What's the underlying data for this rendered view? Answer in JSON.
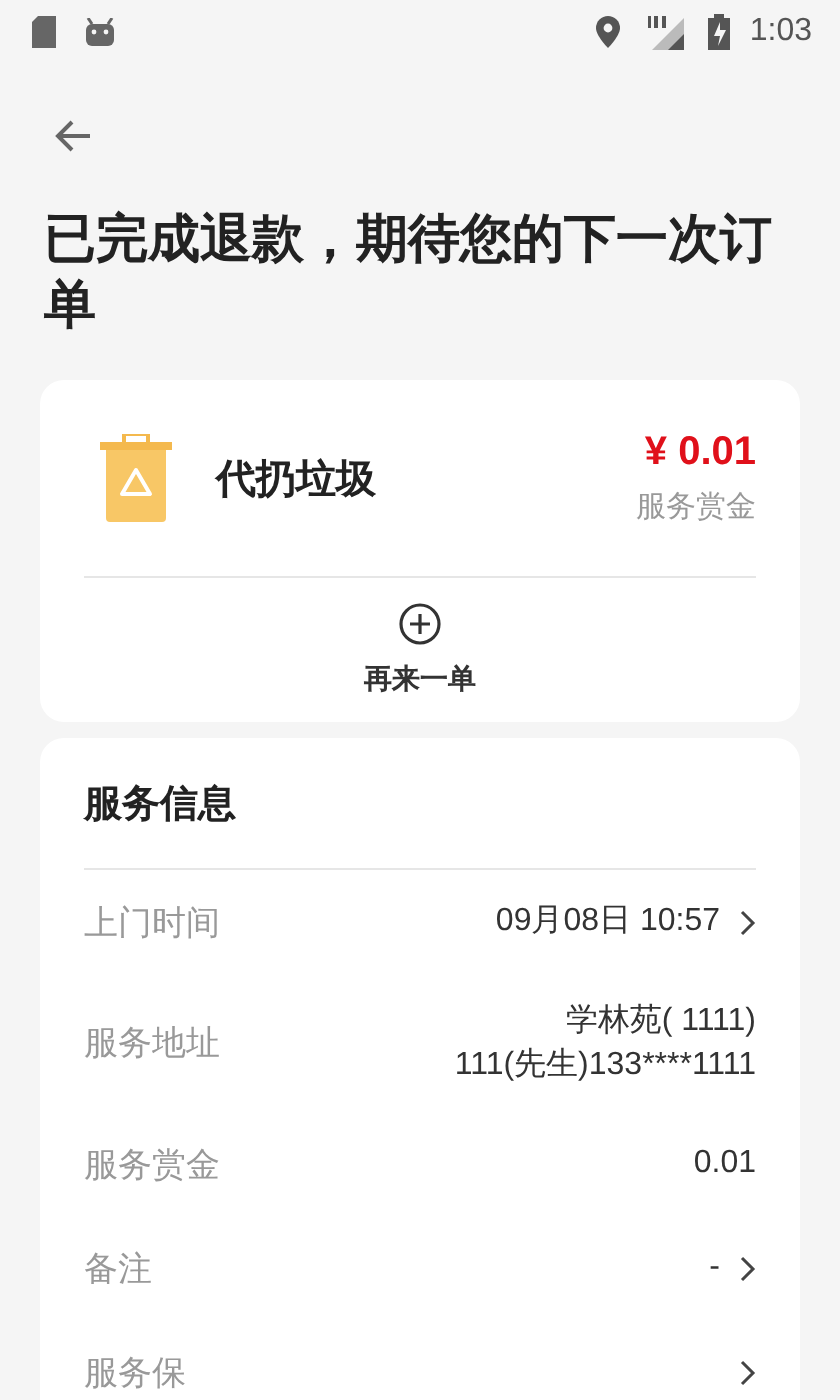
{
  "status_bar": {
    "time": "1:03"
  },
  "title": "已完成退款，期待您的下一次订单",
  "order": {
    "name": "代扔垃圾",
    "price": "¥ 0.01",
    "price_label": "服务赏金",
    "action": "再来一单"
  },
  "info": {
    "heading": "服务信息",
    "rows": [
      {
        "label": "上门时间",
        "lines": [
          "09月08日 10:57"
        ],
        "chevron": true
      },
      {
        "label": "服务地址",
        "lines": [
          "学林苑( 1111)",
          "111(先生)133****1111"
        ],
        "chevron": false
      },
      {
        "label": "服务赏金",
        "lines": [
          "0.01"
        ],
        "chevron": false
      },
      {
        "label": "备注",
        "lines": [
          "-"
        ],
        "chevron": true
      },
      {
        "label": "服务保",
        "lines": [],
        "chevron": true
      }
    ]
  }
}
